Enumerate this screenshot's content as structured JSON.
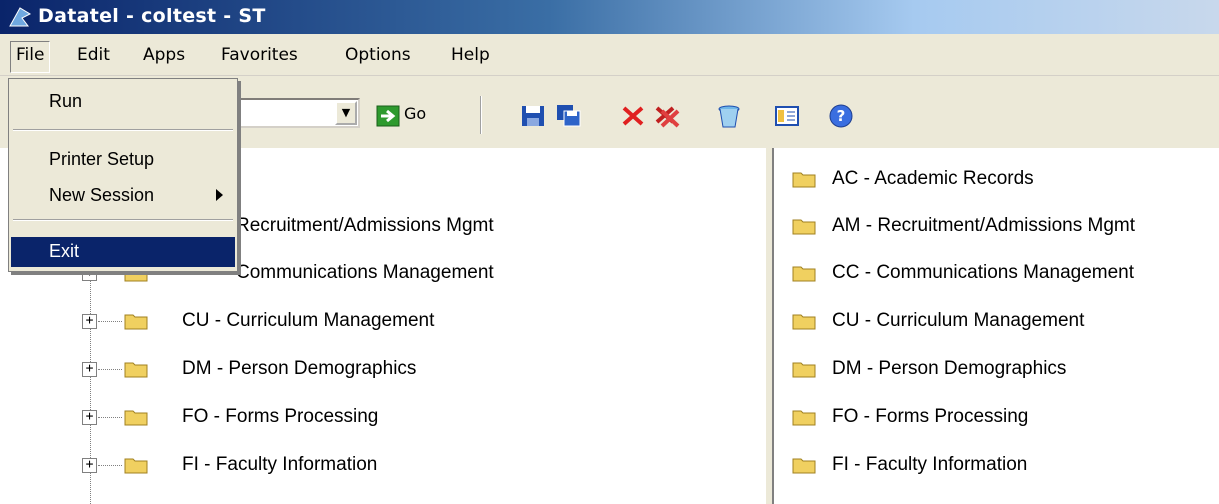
{
  "window": {
    "title": "Datatel - coltest - ST"
  },
  "menubar": {
    "items": [
      "File",
      "Edit",
      "Apps",
      "Favorites",
      "Options",
      "Help"
    ]
  },
  "file_menu": {
    "items": [
      {
        "label": "Run"
      },
      {
        "label": "Printer Setup"
      },
      {
        "label": "New Session"
      },
      {
        "label": "Exit"
      }
    ]
  },
  "toolbar": {
    "combo_value": "",
    "go_label": "Go",
    "icons": [
      "save-icon",
      "save-all-icon",
      "delete-icon",
      "delete-all-icon",
      "trash-icon",
      "view-icon",
      "help-icon"
    ]
  },
  "left_tree": {
    "items": [
      {
        "label": "Recruitment/Admissions Mgmt"
      },
      {
        "label": "Communications Management"
      },
      {
        "label": "CU - Curriculum Management"
      },
      {
        "label": "DM - Person Demographics"
      },
      {
        "label": "FO - Forms Processing"
      },
      {
        "label": "FI - Faculty Information"
      }
    ]
  },
  "right_list": {
    "items": [
      {
        "label": "AC - Academic Records"
      },
      {
        "label": "AM - Recruitment/Admissions Mgmt"
      },
      {
        "label": "CC - Communications Management"
      },
      {
        "label": "CU - Curriculum Management"
      },
      {
        "label": "DM - Person Demographics"
      },
      {
        "label": "FO - Forms Processing"
      },
      {
        "label": "FI - Faculty Information"
      }
    ]
  },
  "colors": {
    "selection": "#0a246a",
    "folder": "#f0d060",
    "chrome": "#ece9d8"
  }
}
